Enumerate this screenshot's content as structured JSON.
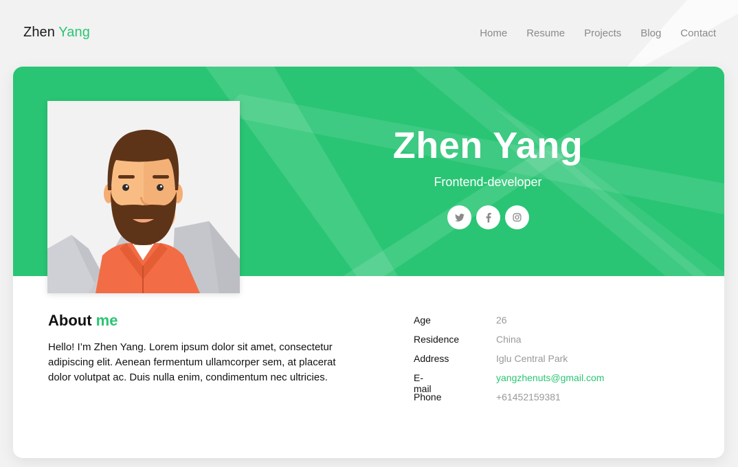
{
  "brand": {
    "first": "Zhen",
    "last": "Yang"
  },
  "nav": [
    "Home",
    "Resume",
    "Projects",
    "Blog",
    "Contact"
  ],
  "hero": {
    "name": "Zhen Yang",
    "role": "Frontend-developer",
    "socials": [
      {
        "icon": "twitter-icon"
      },
      {
        "icon": "facebook-icon"
      },
      {
        "icon": "instagram-icon"
      }
    ]
  },
  "about": {
    "title_plain": "About",
    "title_accent": "me",
    "text": "Hello! I’m Zhen Yang. Lorem ipsum dolor sit amet, consectetur adipiscing elit. Aenean fermentum ullamcorper sem, at placerat dolor volutpat ac. Duis nulla enim, condimentum nec ultricies."
  },
  "info": [
    {
      "label": "Age",
      "value": "26"
    },
    {
      "label": "Residence",
      "value": "China"
    },
    {
      "label": "Address",
      "value": "Iglu Central Park"
    },
    {
      "label": "E-mail",
      "value": "yangzhenuts@gmail.com"
    },
    {
      "label": "Phone",
      "value": "+61452159381"
    }
  ],
  "colors": {
    "accent": "#2bc573",
    "hero_bg": "#29c574",
    "page_bg": "#f2f2f2",
    "muted": "#999999"
  }
}
